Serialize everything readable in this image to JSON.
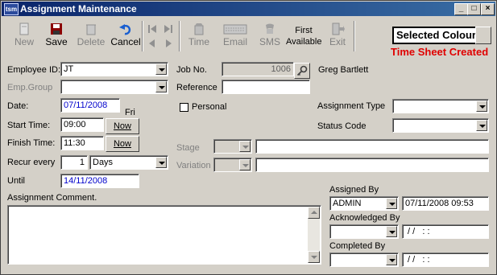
{
  "window": {
    "title": "Assignment Maintenance",
    "app_icon_text": "tsm"
  },
  "titlebar_buttons": {
    "minimize": "_",
    "maximize": "□",
    "close": "×"
  },
  "toolbar": {
    "new_label": "New",
    "save_label": "Save",
    "delete_label": "Delete",
    "cancel_label": "Cancel",
    "time_label": "Time",
    "email_label": "Email",
    "sms_label": "SMS",
    "first_available_label_1": "First",
    "first_available_label_2": "Available",
    "exit_label": "Exit"
  },
  "status": {
    "selected_colour": "Selected Colour",
    "time_sheet_created": "Time Sheet Created"
  },
  "form": {
    "employee_id_label": "Employee ID:",
    "employee_id_value": "JT",
    "emp_group_label": "Emp.Group",
    "emp_group_value": "",
    "date_label": "Date:",
    "date_value": "07/11/2008",
    "day_value": "Fri",
    "start_time_label": "Start Time:",
    "start_time_value": "09:00",
    "finish_time_label": "Finish Time:",
    "finish_time_value": "11:30",
    "now_label": "Now",
    "recur_every_label": "Recur every",
    "recur_every_value": "1",
    "recur_unit_value": "Days",
    "until_label": "Until",
    "until_value": "14/11/2008",
    "job_no_label": "Job No.",
    "job_no_value": "1006",
    "employee_name": "Greg Bartlett",
    "reference_label": "Reference",
    "reference_value": "",
    "personal_label": "Personal",
    "assignment_type_label": "Assignment Type",
    "assignment_type_value": "",
    "status_code_label": "Status Code",
    "status_code_value": "",
    "stage_label": "Stage",
    "variation_label": "Variation",
    "assignment_comment_label": "Assignment Comment.",
    "assignment_comment_value": "",
    "assigned_by_label": "Assigned By",
    "assigned_by_value": "ADMIN",
    "assigned_by_datetime": "07/11/2008 09:53",
    "acknowledged_by_label": "Acknowledged By",
    "acknowledged_by_value": "",
    "acknowledged_by_datetime": " / /   : :",
    "completed_by_label": "Completed By",
    "completed_by_value": "",
    "completed_by_datetime": " / /   : :"
  }
}
